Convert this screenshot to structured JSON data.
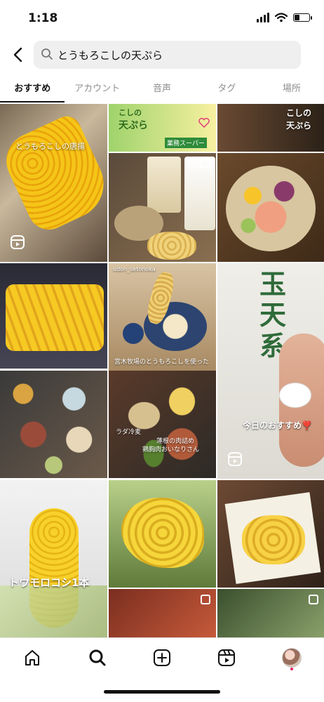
{
  "status_bar": {
    "time": "1:18"
  },
  "search": {
    "query": "とうもろこしの天ぷら"
  },
  "tabs": [
    {
      "label": "おすすめ",
      "active": true
    },
    {
      "label": "アカウント",
      "active": false
    },
    {
      "label": "音声",
      "active": false
    },
    {
      "label": "タグ",
      "active": false
    },
    {
      "label": "場所",
      "active": false
    }
  ],
  "grid": {
    "overlays": {
      "t1": "とうもろこしの唐揚",
      "t2_title_a": "こしの",
      "t2_title_b": "天ぷら",
      "t2_brand": "業務スーパー",
      "t6_title_a": "こしの",
      "t6_title_b": "天ぷら",
      "t9_user": "udon_setonoka",
      "t9_caption": "宮木牧場のとうもろこしを使った",
      "t10": "今日のおすすめ❣️",
      "t12_a": "ラダ冷麦",
      "t12_b": "蓮根の肉詰め",
      "t12_c": "鶏胸肉おいなりさん",
      "t13": "トウモロコシ1本"
    }
  },
  "colors": {
    "corn": "#f2c21b",
    "tab_active": "#111111",
    "tab_inactive": "#8e8e8e",
    "search_bg": "#efefef"
  },
  "icons": {
    "back": "chevron-left-icon",
    "search": "magnifier-icon",
    "home": "home-icon",
    "explore": "search-icon",
    "create": "plus-square-icon",
    "reels": "reels-icon",
    "profile": "avatar"
  }
}
